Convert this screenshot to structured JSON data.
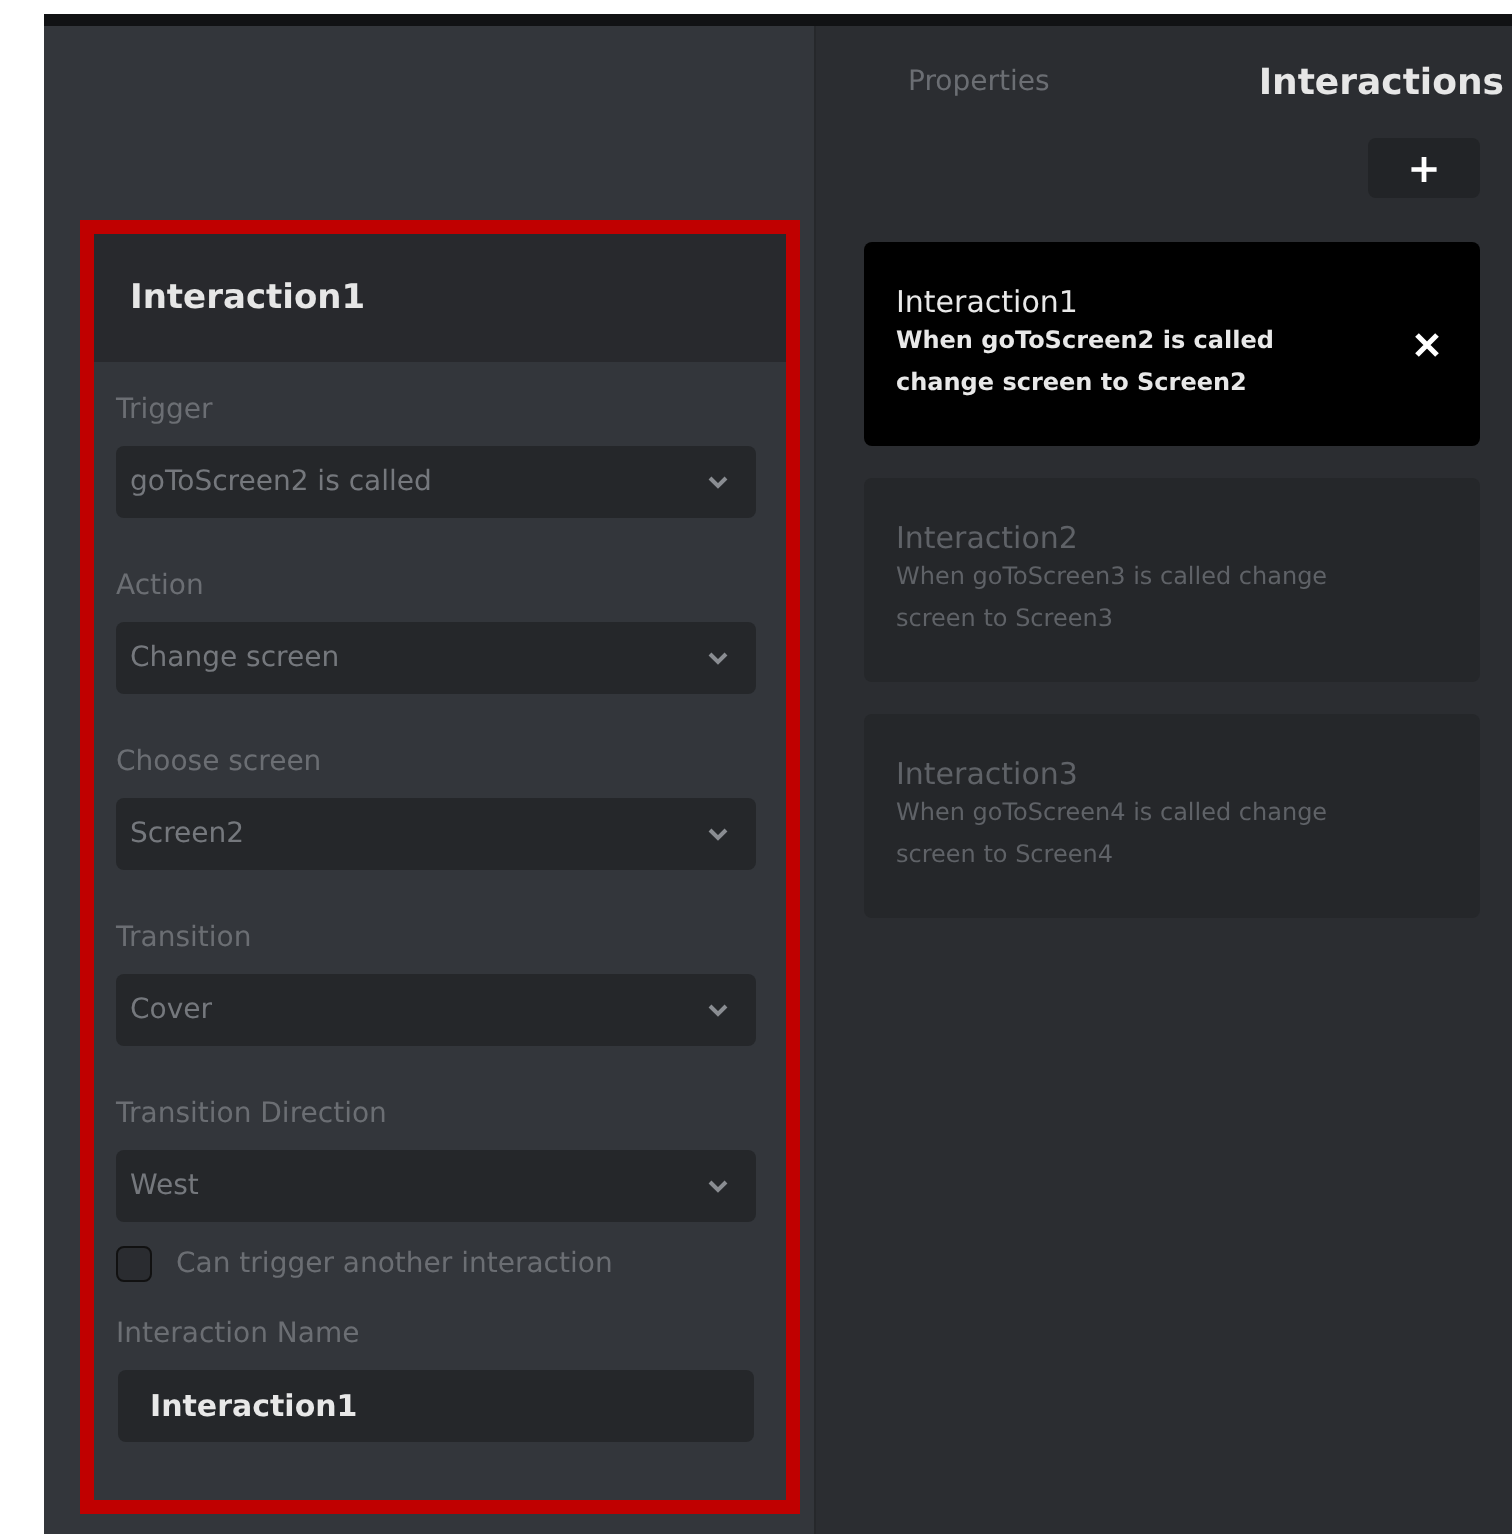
{
  "editor": {
    "title": "Interaction1",
    "fields": [
      {
        "label": "Trigger",
        "value": "goToScreen2 is called"
      },
      {
        "label": "Action",
        "value": "Change screen"
      },
      {
        "label": "Choose screen",
        "value": "Screen2"
      },
      {
        "label": "Transition",
        "value": "Cover"
      },
      {
        "label": "Transition Direction",
        "value": "West"
      }
    ],
    "checkbox": {
      "label": "Can trigger another interaction",
      "checked": false
    },
    "name_field": {
      "label": "Interaction Name",
      "value": "Interaction1"
    }
  },
  "tabs": [
    {
      "label": "Properties",
      "selected": false
    },
    {
      "label": "Interactions",
      "selected": true
    }
  ],
  "add_button": {
    "label": "+"
  },
  "interactions": [
    {
      "name": "Interaction1",
      "description": "When goToScreen2 is called change screen to Screen2",
      "selected": true
    },
    {
      "name": "Interaction2",
      "description": "When goToScreen3 is called change screen to Screen3",
      "selected": false
    },
    {
      "name": "Interaction3",
      "description": "When goToScreen4 is called change screen to Screen4",
      "selected": false
    }
  ]
}
